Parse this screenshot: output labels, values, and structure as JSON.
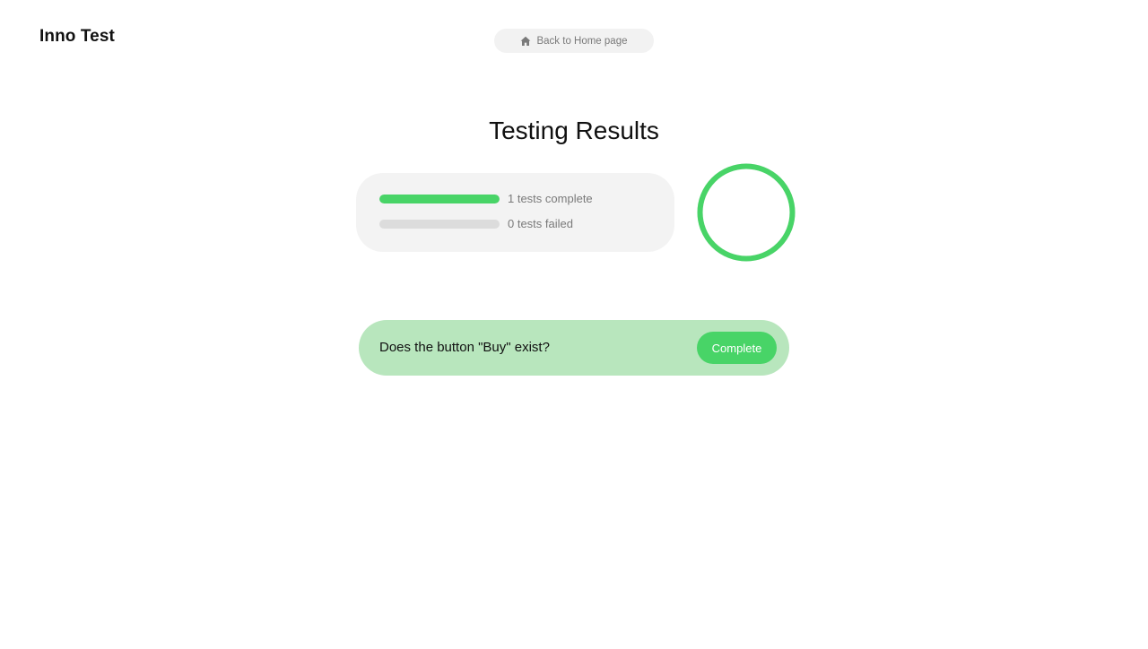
{
  "header": {
    "brand": "Inno Test",
    "home_link": {
      "label": "Back to Home page",
      "icon": "home-icon"
    }
  },
  "results": {
    "title": "Testing Results",
    "complete": {
      "label": "1 tests complete",
      "fraction": 1.0,
      "color": "#48d467"
    },
    "failed": {
      "label": "0 tests failed",
      "fraction": 0.0,
      "color": "#e05555"
    },
    "ring": {
      "pass_fraction": 1.0,
      "color": "#48d467"
    }
  },
  "tests": [
    {
      "question": "Does the button \"Buy\" exist?",
      "status": "Complete",
      "status_color": "#48d467",
      "card_color": "#b8e6bd"
    }
  ]
}
